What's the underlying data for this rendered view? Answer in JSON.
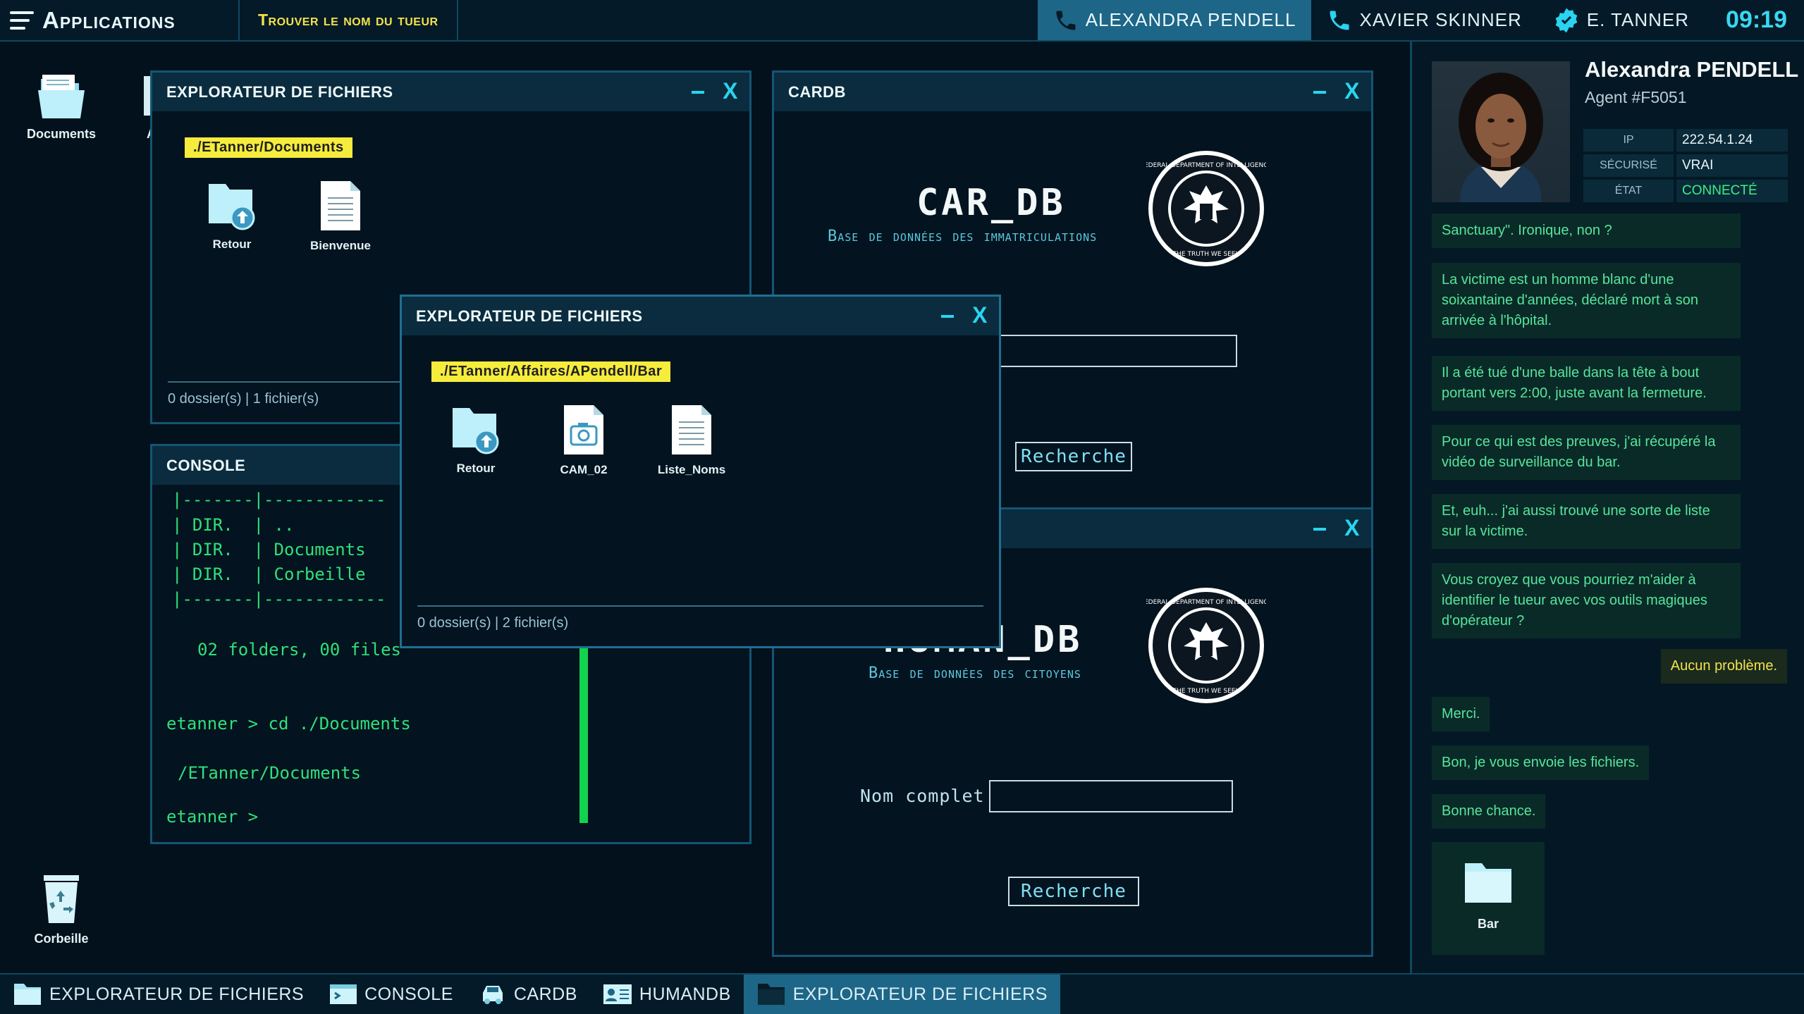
{
  "topbar": {
    "apps_label": "Applications",
    "mission_label": "Trouver le nom du tueur",
    "contacts": [
      {
        "name": "ALEXANDRA PENDELL",
        "icon": "phone-icon"
      },
      {
        "name": "XAVIER SKINNER",
        "icon": "phone-icon"
      },
      {
        "name": "E. TANNER",
        "icon": "badge-icon"
      }
    ],
    "clock": "09:19"
  },
  "desktop": {
    "icons": [
      {
        "label": "Documents",
        "icon": "folder-icon"
      },
      {
        "label": "A",
        "icon": "app-icon"
      },
      {
        "label": "Corbeille",
        "icon": "recycle-bin-icon"
      }
    ]
  },
  "explorer1": {
    "title": "EXPLORATEUR DE FICHIERS",
    "path": "./ETanner/Documents",
    "items": [
      {
        "label": "Retour",
        "icon": "folder-back-icon"
      },
      {
        "label": "Bienvenue",
        "icon": "document-icon"
      }
    ],
    "footer": "0 dossier(s) | 1 fichier(s)"
  },
  "explorer2": {
    "title": "EXPLORATEUR DE FICHIERS",
    "path": "./ETanner/Affaires/APendell/Bar",
    "items": [
      {
        "label": "Retour",
        "icon": "folder-back-icon"
      },
      {
        "label": "CAM_02",
        "icon": "camera-file-icon"
      },
      {
        "label": "Liste_Noms",
        "icon": "document-icon"
      }
    ],
    "footer": "0 dossier(s) | 2 fichier(s)"
  },
  "console": {
    "title": "CONSOLE",
    "lines": [
      "|-------|------------",
      "| DIR.  | ..",
      "| DIR.  | Documents",
      "| DIR.  | Corbeille",
      "|-------|------------",
      "02 folders, 00 files",
      "etanner > cd ./Documents",
      "/ETanner/Documents",
      "etanner >"
    ]
  },
  "cardb": {
    "title": "CARDB",
    "heading": "CAR_DB",
    "subtitle": "Base de données des immatriculations",
    "button": "Recherche",
    "seal_text": "FEDERAL DEPARTMENT OF INTELLIGENCE",
    "seal_motto": "THE TRUTH WE SEEK"
  },
  "humandb": {
    "heading": "HUMAN_DB",
    "subtitle": "Base de données des citoyens",
    "field_label": "Nom complet",
    "button": "Recherche",
    "seal_text": "FEDERAL DEPARTMENT OF INTELLIGENCE",
    "seal_motto": "THE TRUTH WE SEEK"
  },
  "chat": {
    "agent_name": "Alexandra PENDELL",
    "agent_id": "Agent #F5051",
    "info": [
      {
        "key": "IP",
        "value": "222.54.1.24"
      },
      {
        "key": "SÉCURISÉ",
        "value": "VRAI"
      },
      {
        "key": "ÉTAT",
        "value": "CONNECTÉ"
      }
    ],
    "messages": [
      {
        "from": "them",
        "text": "Sanctuary\". Ironique, non ?"
      },
      {
        "from": "them",
        "text": "La victime est un homme blanc d'une soixantaine d'années, déclaré mort à son arrivée à l'hôpital."
      },
      {
        "from": "them",
        "text": "Il a été tué d'une balle dans la tête à bout portant vers 2:00, juste avant la fermeture."
      },
      {
        "from": "them",
        "text": "Pour ce qui est des preuves, j'ai récupéré la vidéo de surveillance du bar."
      },
      {
        "from": "them",
        "text": "Et, euh... j'ai aussi trouvé une sorte de liste sur la victime."
      },
      {
        "from": "them",
        "text": "Vous croyez que vous pourriez m'aider à identifier le tueur avec vos outils magiques d'opérateur ?"
      },
      {
        "from": "me",
        "text": "Aucun problème."
      },
      {
        "from": "them",
        "text": "Merci."
      },
      {
        "from": "them",
        "text": "Bon, je vous envoie les fichiers."
      },
      {
        "from": "them",
        "text": "Bonne chance."
      }
    ],
    "attachment": "Bar"
  },
  "taskbar": {
    "tasks": [
      {
        "label": "EXPLORATEUR DE FICHIERS",
        "icon": "folder-icon"
      },
      {
        "label": "CONSOLE",
        "icon": "console-icon"
      },
      {
        "label": "CARDB",
        "icon": "car-icon"
      },
      {
        "label": "HUMANDB",
        "icon": "id-card-icon"
      },
      {
        "label": "EXPLORATEUR DE FICHIERS",
        "icon": "folder-icon"
      }
    ]
  },
  "colors": {
    "accent": "#2ad4f0",
    "path_tag": "#f5ec3c",
    "console_text": "#2fe07a",
    "chat_them": "#56e59a",
    "chat_me": "#f2e24c"
  }
}
